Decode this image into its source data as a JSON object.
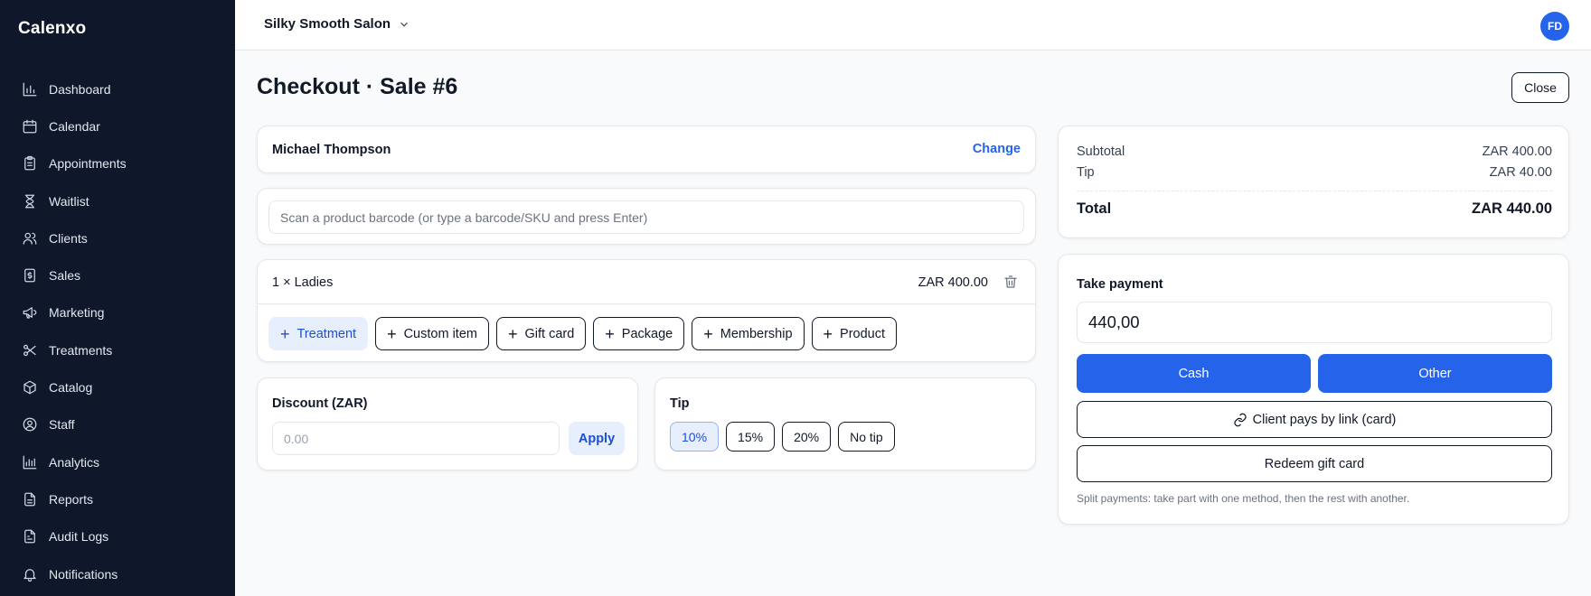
{
  "app": {
    "brand": "Calenxo"
  },
  "sidebar": {
    "items": [
      {
        "label": "Dashboard",
        "icon": "bar-chart-icon"
      },
      {
        "label": "Calendar",
        "icon": "calendar-icon"
      },
      {
        "label": "Appointments",
        "icon": "clipboard-icon"
      },
      {
        "label": "Waitlist",
        "icon": "hourglass-icon"
      },
      {
        "label": "Clients",
        "icon": "users-icon"
      },
      {
        "label": "Sales",
        "icon": "dollar-receipt-icon"
      },
      {
        "label": "Marketing",
        "icon": "megaphone-icon"
      },
      {
        "label": "Treatments",
        "icon": "scissors-icon"
      },
      {
        "label": "Catalog",
        "icon": "box-icon"
      },
      {
        "label": "Staff",
        "icon": "user-circle-icon"
      },
      {
        "label": "Analytics",
        "icon": "analytics-icon"
      },
      {
        "label": "Reports",
        "icon": "file-icon"
      },
      {
        "label": "Audit Logs",
        "icon": "file-text-icon"
      },
      {
        "label": "Notifications",
        "icon": "bell-icon"
      }
    ]
  },
  "topbar": {
    "salon": "Silky Smooth Salon",
    "avatar": "FD"
  },
  "page": {
    "title": "Checkout · Sale #6",
    "close_label": "Close"
  },
  "client": {
    "name": "Michael Thompson",
    "change_label": "Change"
  },
  "scan": {
    "placeholder": "Scan a product barcode (or type a barcode/SKU and press Enter)"
  },
  "items": [
    {
      "label": "1 × Ladies",
      "price": "ZAR 400.00"
    }
  ],
  "add_buttons": [
    "Treatment",
    "Custom item",
    "Gift card",
    "Package",
    "Membership",
    "Product"
  ],
  "discount": {
    "label": "Discount (ZAR)",
    "placeholder": "0.00",
    "apply_label": "Apply"
  },
  "tip": {
    "label": "Tip",
    "options": [
      "10%",
      "15%",
      "20%",
      "No tip"
    ],
    "selected": "10%"
  },
  "summary": {
    "subtotal_label": "Subtotal",
    "subtotal": "ZAR 400.00",
    "tip_label": "Tip",
    "tip": "ZAR 40.00",
    "total_label": "Total",
    "total": "ZAR 440.00"
  },
  "payment": {
    "label": "Take payment",
    "amount": "440,00",
    "cash_label": "Cash",
    "other_label": "Other",
    "link_label": "Client pays by link (card)",
    "gift_label": "Redeem gift card",
    "split_note": "Split payments: take part with one method, then the rest with another."
  },
  "colors": {
    "sidebar_bg": "#0f172a",
    "primary": "#2563eb",
    "accent_soft": "#e8effc"
  }
}
